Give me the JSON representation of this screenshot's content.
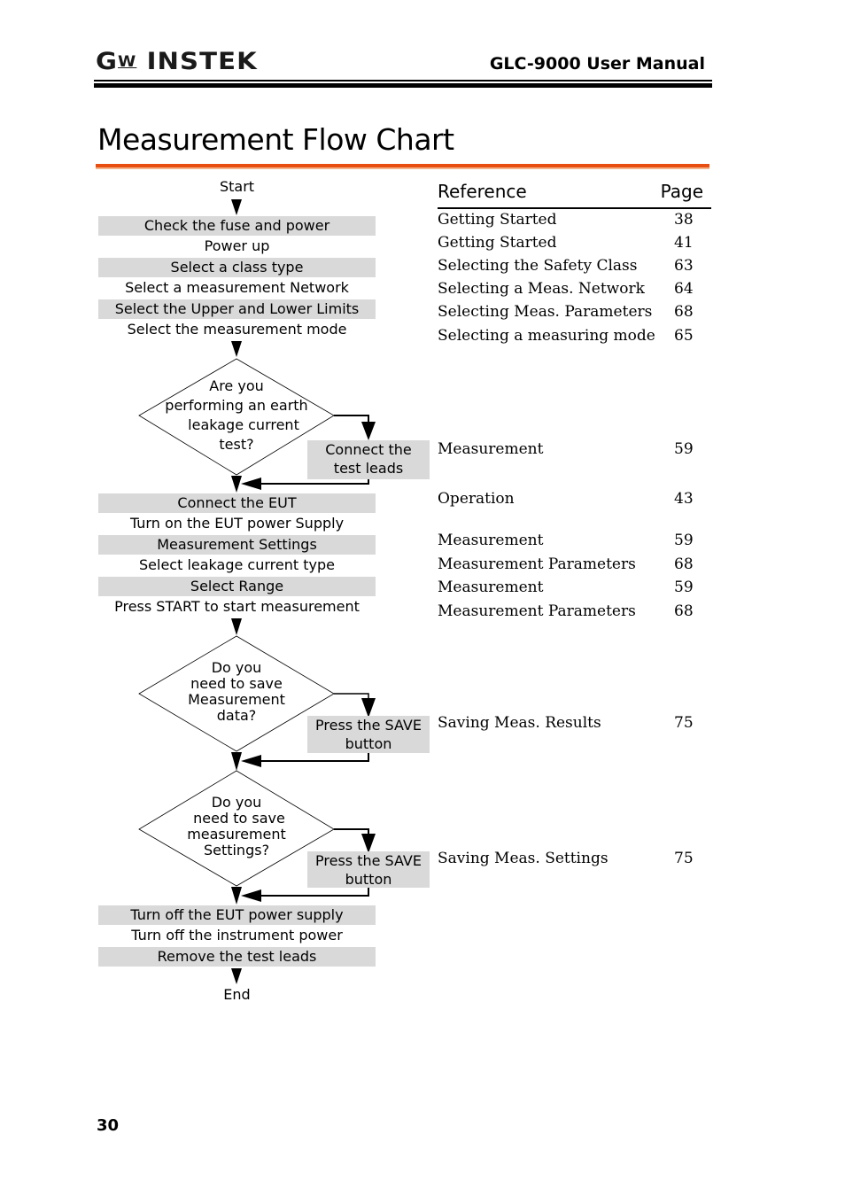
{
  "header": {
    "logo_text": "GW INSTEK",
    "logo_prefix": "G",
    "logo_w": "W",
    "logo_suffix": "INSTEK",
    "manual_title": "GLC-9000 User Manual"
  },
  "page_title": "Measurement Flow Chart",
  "colors": {
    "accent_orange": "#e84e0f",
    "accent_orange_light": "#f5b38a",
    "step_shade": "#d9d9d9"
  },
  "flowchart": {
    "start": "Start",
    "end": "End",
    "block1": [
      "Check the fuse and power",
      "Power up",
      "Select a class type",
      "Select a measurement Network",
      "Select the Upper and Lower Limits",
      "Select the measurement mode"
    ],
    "decision1": {
      "lines": [
        "Are you",
        "performing an earth",
        "leakage current",
        "test?"
      ],
      "action_lines": [
        "Connect the",
        "test leads"
      ]
    },
    "block2": [
      "Connect the EUT",
      "Turn on the EUT power Supply",
      "Measurement Settings",
      "Select leakage current type",
      "Select Range",
      "Press START to start measurement"
    ],
    "decision2": {
      "lines": [
        "Do you",
        "need to save",
        "Measurement",
        "data?"
      ],
      "action_lines": [
        "Press the SAVE",
        "button"
      ]
    },
    "decision3": {
      "lines": [
        "Do you",
        "need to save",
        "measurement",
        "Settings?"
      ],
      "action_lines": [
        "Press the SAVE",
        "button"
      ]
    },
    "block3": [
      "Turn off the EUT power supply",
      "Turn off the instrument power",
      "Remove the test leads"
    ]
  },
  "reference_table": {
    "header_reference": "Reference",
    "header_page": "Page",
    "rows": [
      {
        "reference": "Getting Started",
        "page": "38"
      },
      {
        "reference": "Getting Started",
        "page": "41"
      },
      {
        "reference": "Selecting the Safety Class",
        "page": "63"
      },
      {
        "reference": "Selecting a Meas. Network",
        "page": "64"
      },
      {
        "reference": "Selecting Meas. Parameters",
        "page": "68"
      },
      {
        "reference": "Selecting a measuring mode",
        "page": "65"
      },
      {
        "reference": "Measurement",
        "page": "59"
      },
      {
        "reference": "Operation",
        "page": "43"
      },
      {
        "reference": "Measurement",
        "page": "59"
      },
      {
        "reference": "Measurement Parameters",
        "page": "68"
      },
      {
        "reference": "Measurement",
        "page": "59"
      },
      {
        "reference": "Measurement Parameters",
        "page": "68"
      },
      {
        "reference": "Saving Meas. Results",
        "page": "75"
      },
      {
        "reference": "Saving Meas.  Settings",
        "page": "75"
      }
    ]
  },
  "page_number": "30"
}
